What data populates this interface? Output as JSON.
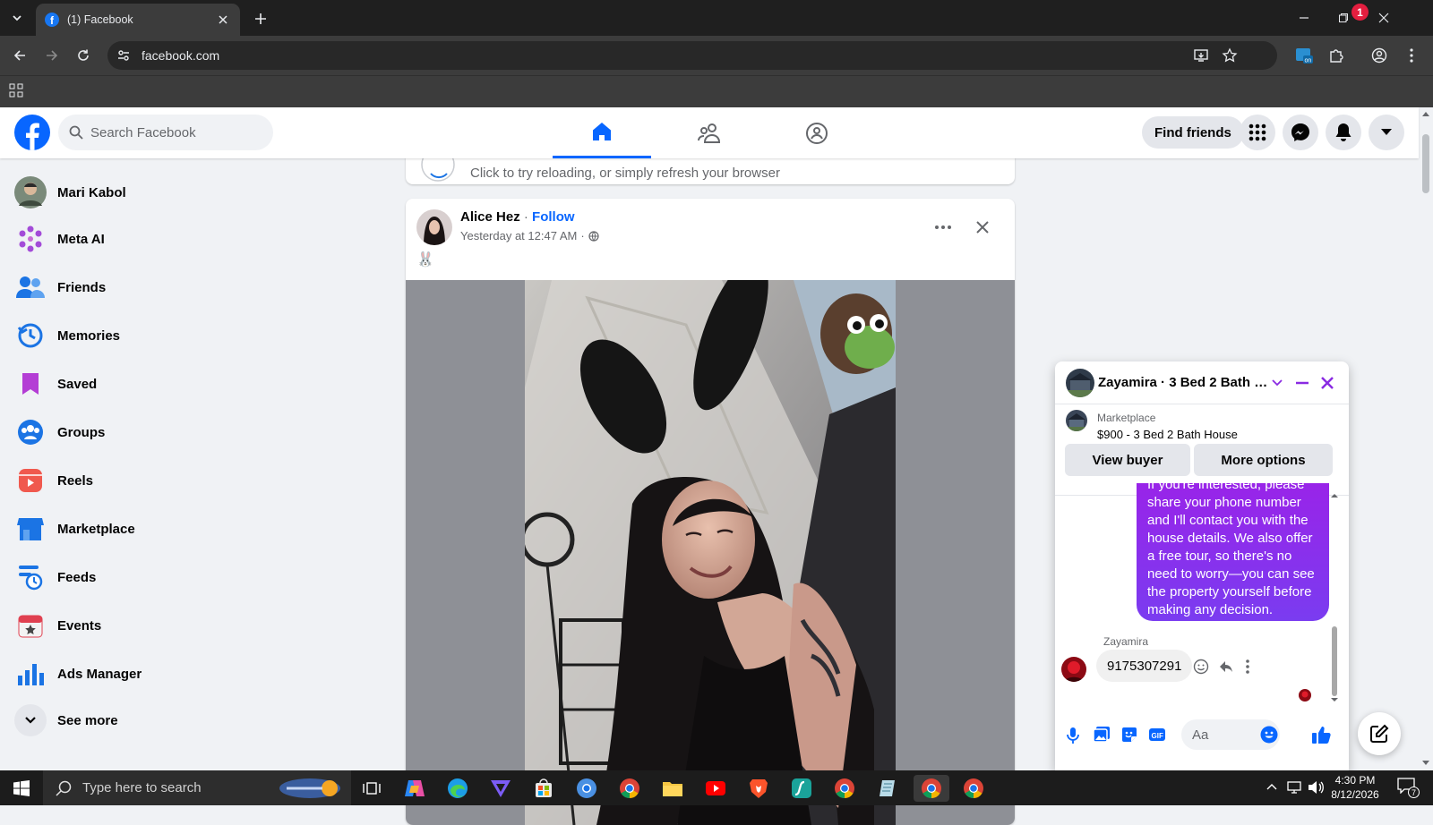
{
  "browser": {
    "tab_title": "(1) Facebook",
    "url": "facebook.com"
  },
  "header": {
    "search_placeholder": "Search Facebook",
    "find_friends": "Find friends",
    "notification_count": "1"
  },
  "sidebar": {
    "items": [
      {
        "label": "Mari Kabol",
        "icon": "profile-avatar"
      },
      {
        "label": "Meta AI",
        "icon": "meta-ai-icon"
      },
      {
        "label": "Friends",
        "icon": "friends-icon"
      },
      {
        "label": "Memories",
        "icon": "memories-icon"
      },
      {
        "label": "Saved",
        "icon": "saved-icon"
      },
      {
        "label": "Groups",
        "icon": "groups-icon"
      },
      {
        "label": "Reels",
        "icon": "reels-icon"
      },
      {
        "label": "Marketplace",
        "icon": "marketplace-icon"
      },
      {
        "label": "Feeds",
        "icon": "feeds-icon"
      },
      {
        "label": "Events",
        "icon": "events-icon"
      },
      {
        "label": "Ads Manager",
        "icon": "ads-manager-icon"
      },
      {
        "label": "See more",
        "icon": "chevron-down-icon"
      }
    ]
  },
  "feed": {
    "reload_text": "Click to try reloading, or simply refresh your browser",
    "post": {
      "author": "Alice Hez",
      "separator": "·",
      "follow": "Follow",
      "time": "Yesterday at 12:47 AM",
      "time_sep": "·",
      "caption": "🐰"
    }
  },
  "chat": {
    "title": "Zayamira · 3 Bed 2 Bath H...",
    "marketplace_label": "Marketplace",
    "listing": "$900 - 3 Bed 2 Bath House",
    "view_buyer": "View buyer",
    "more_options": "More options",
    "sent_message": "If you're interested, please share your phone number and I'll contact you with the house details. We also offer a free tour, so there's no need to worry—you can see the property yourself before making any decision.",
    "reply_sender": "Zayamira",
    "reply_message": "9175307291",
    "input_placeholder": "Aa",
    "accent_color": "#8a2be2"
  },
  "taskbar": {
    "search_text": "Type here to search",
    "time": "4:30 PM",
    "date": "8/12/2026",
    "notification_count": "7"
  },
  "colors": {
    "fb_blue": "#0866ff",
    "chat_gradient_top": "#9b22e8",
    "chat_gradient_bottom": "#7a3cf0",
    "badge_red": "#e41e3f"
  }
}
